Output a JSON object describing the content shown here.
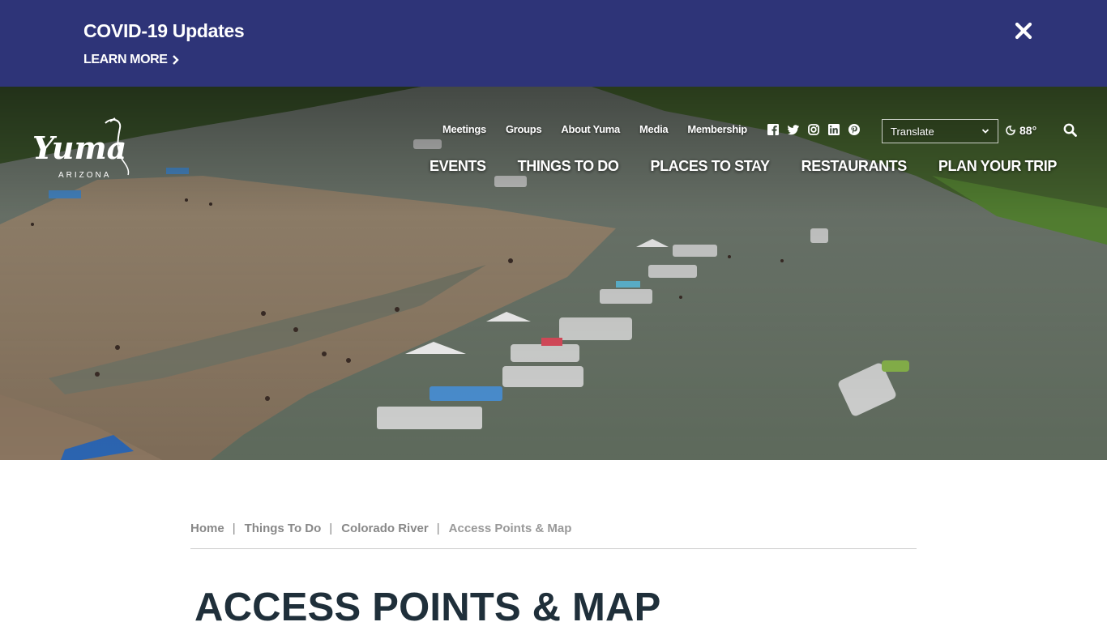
{
  "banner": {
    "title": "COVID-19 Updates",
    "link_label": "LEARN MORE",
    "bg_color": "#2e3478"
  },
  "utility_nav": [
    "Meetings",
    "Groups",
    "About Yuma",
    "Media",
    "Membership"
  ],
  "social_icons": [
    "facebook-icon",
    "twitter-icon",
    "instagram-icon",
    "linkedin-icon",
    "pinterest-icon"
  ],
  "translate": {
    "label": "Translate"
  },
  "weather": {
    "temp": "88°",
    "icon": "moon-icon"
  },
  "main_nav": [
    "EVENTS",
    "THINGS TO DO",
    "PLACES TO STAY",
    "RESTAURANTS",
    "PLAN YOUR TRIP"
  ],
  "logo": {
    "wordmark": "Yuma",
    "subtitle": "ARIZONA"
  },
  "breadcrumb": [
    "Home",
    "Things To Do",
    "Colorado River",
    "Access Points & Map"
  ],
  "page": {
    "title": "ACCESS POINTS & MAP"
  }
}
